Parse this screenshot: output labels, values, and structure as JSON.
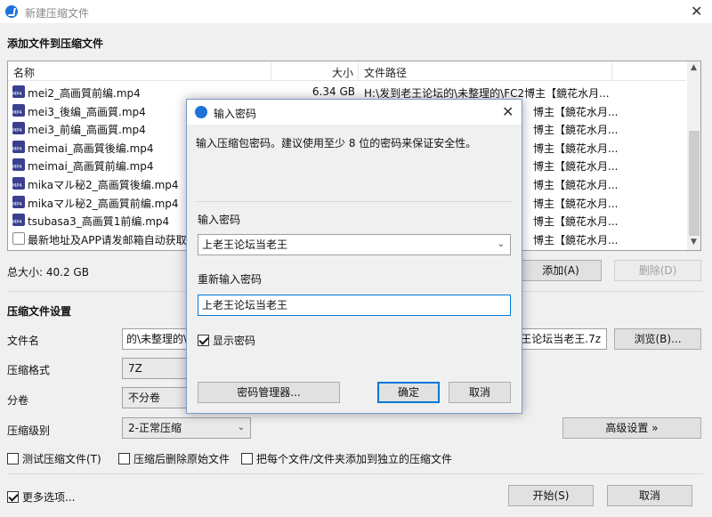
{
  "window": {
    "title": "新建压缩文件",
    "close": "✕"
  },
  "section_add": "添加文件到压缩文件",
  "list": {
    "headers": {
      "name": "名称",
      "size": "大小",
      "path": "文件路径"
    },
    "rows": [
      {
        "name": "mei2_高画質前编.mp4",
        "size": "6.34 GB",
        "path": "H:\\发到老王论坛的\\未整理的\\FC2博主【鏡花水月...",
        "icon": "video-file-icon"
      },
      {
        "name": "mei3_後编_高画質.mp4",
        "size": "",
        "path": "博主【鏡花水月...",
        "icon": "video-file-icon"
      },
      {
        "name": "mei3_前编_高画質.mp4",
        "size": "",
        "path": "博主【鏡花水月...",
        "icon": "video-file-icon"
      },
      {
        "name": "meimai_高画質後编.mp4",
        "size": "",
        "path": "博主【鏡花水月...",
        "icon": "video-file-icon"
      },
      {
        "name": "meimai_高画質前编.mp4",
        "size": "",
        "path": "博主【鏡花水月...",
        "icon": "video-file-icon"
      },
      {
        "name": "mikaマル秘2_高画質後编.mp4",
        "size": "",
        "path": "博主【鏡花水月...",
        "icon": "video-file-icon"
      },
      {
        "name": "mikaマル秘2_高画質前编.mp4",
        "size": "",
        "path": "博主【鏡花水月...",
        "icon": "video-file-icon"
      },
      {
        "name": "tsubasa3_高画質1前编.mp4",
        "size": "",
        "path": "博主【鏡花水月...",
        "icon": "video-file-icon"
      },
      {
        "name": "最新地址及APP请发邮箱自动获取!",
        "size": "",
        "path": "博主【鏡花水月...",
        "icon": "text-file-icon"
      }
    ]
  },
  "total_size": "总大小: 40.2 GB",
  "buttons": {
    "add": "添加(A)",
    "delete": "删除(D)",
    "browse": "浏览(B)...",
    "advanced": "高级设置 »",
    "start": "开始(S)",
    "cancel": "取消"
  },
  "section_settings": "压缩文件设置",
  "settings": {
    "filename_label": "文件名",
    "filename_left": "的\\未整理的\\F",
    "filename_right": "王论坛当老王.7z",
    "format_label": "压缩格式",
    "format_value": "7Z",
    "split_label": "分卷",
    "split_value": "不分卷",
    "level_label": "压缩级别",
    "level_value": "2-正常压缩"
  },
  "options": {
    "test": "测试压缩文件(T)",
    "delete_after": "压缩后删除原始文件",
    "separate": "把每个文件/文件夹添加到独立的压缩文件",
    "more": "更多选项..."
  },
  "dialog": {
    "title": "输入密码",
    "close": "✕",
    "message": "输入压缩包密码。建议使用至少 8 位的密码来保证安全性。",
    "password_label": "输入密码",
    "password_value": "上老王论坛当老王",
    "confirm_label": "重新输入密码",
    "confirm_value": "上老王论坛当老王",
    "show_password": "显示密码",
    "manager_button": "密码管理器...",
    "ok_button": "确定",
    "cancel_button": "取消"
  },
  "colors": {
    "accent": "#0078d7",
    "app_icon": "#1e73d8"
  }
}
